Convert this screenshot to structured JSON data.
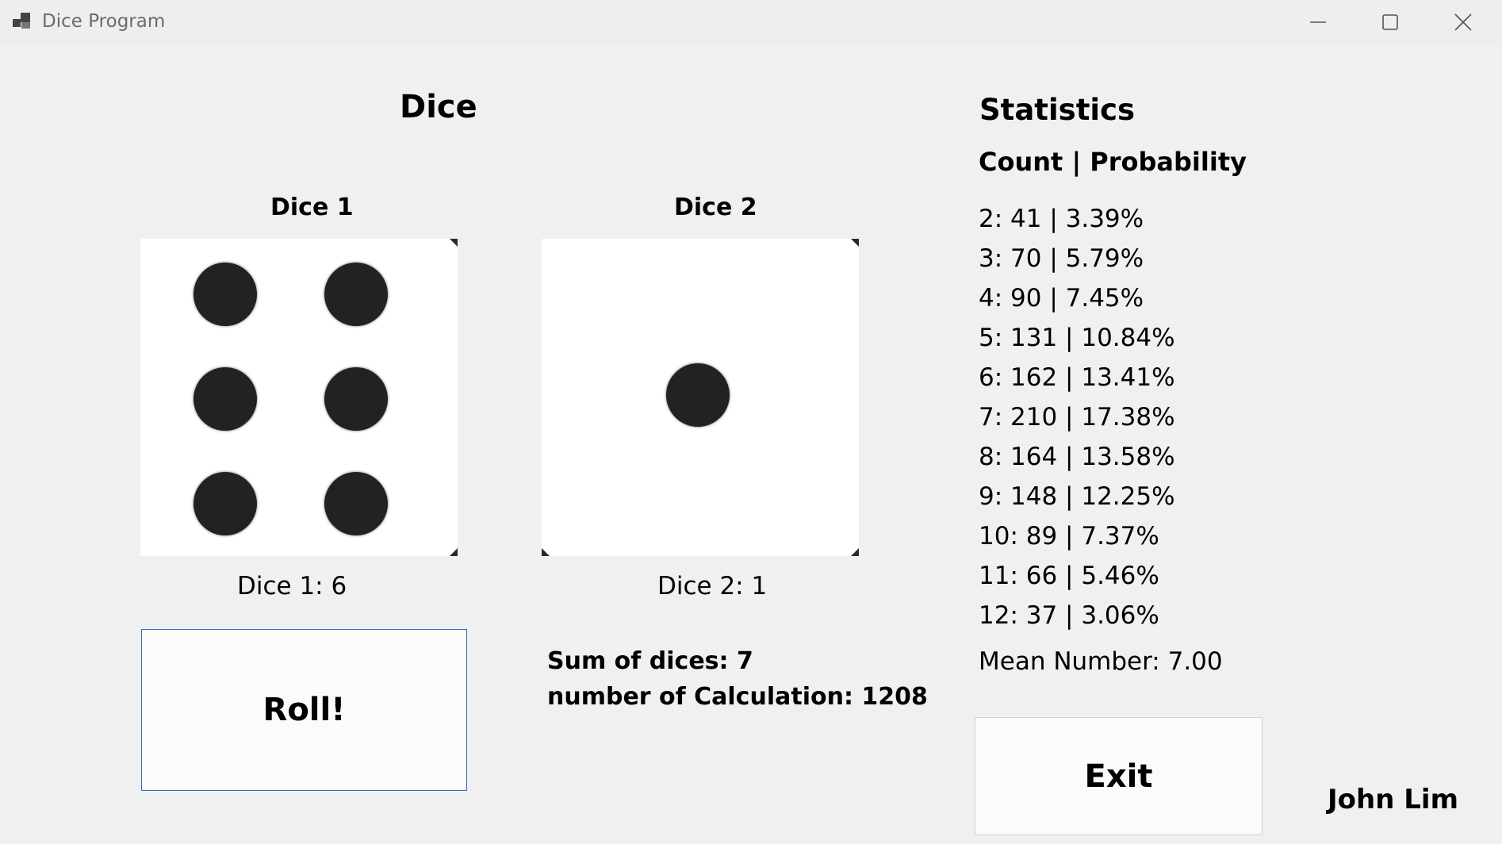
{
  "window": {
    "title": "Dice Program",
    "minimize_icon": "minimize-icon",
    "maximize_icon": "maximize-icon",
    "close_icon": "close-icon"
  },
  "dice_section": {
    "heading": "Dice",
    "dice1_label": "Dice 1",
    "dice2_label": "Dice 2",
    "dice1_value_text": "Dice 1: 6",
    "dice2_value_text": "Dice 2: 1",
    "dice1_value": 6,
    "dice2_value": 1
  },
  "roll_button": {
    "label": "Roll!"
  },
  "summary": {
    "sum_text": "Sum of dices: 7",
    "calc_text": "number of Calculation: 1208"
  },
  "statistics": {
    "heading": "Statistics",
    "columns_header": "Count | Probability",
    "rows": [
      "2: 41 | 3.39%",
      "3: 70 | 5.79%",
      "4: 90 | 7.45%",
      "5: 131 | 10.84%",
      "6: 162 | 13.41%",
      "7: 210 | 17.38%",
      "8: 164 | 13.58%",
      "9: 148 | 12.25%",
      "10: 89 | 7.37%",
      "11: 66 | 5.46%",
      "12: 37 | 3.06%"
    ],
    "mean_text": "Mean Number: 7.00"
  },
  "exit_button": {
    "label": "Exit"
  },
  "author": "John Lim"
}
